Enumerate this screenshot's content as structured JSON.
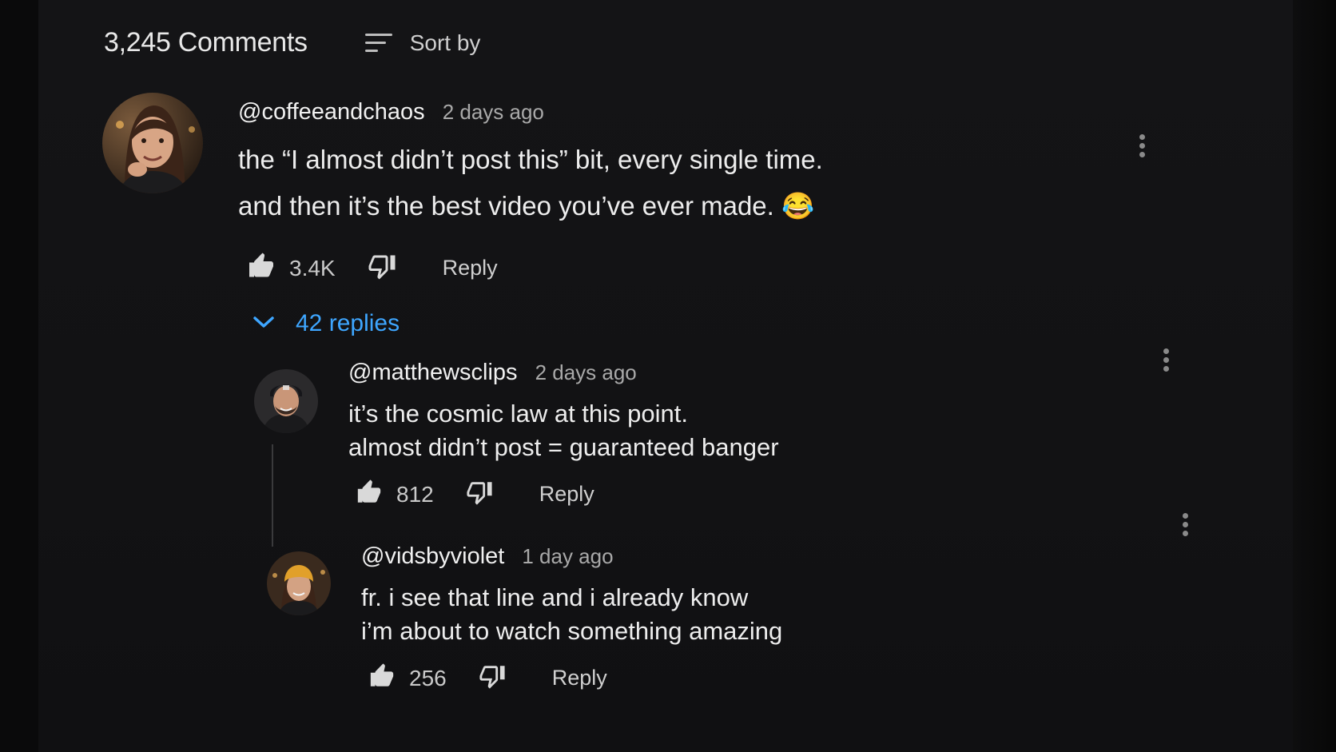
{
  "header": {
    "comment_count": "3,245 Comments",
    "sort_label": "Sort by",
    "sort_icon": "sort-icon"
  },
  "comment": {
    "author": "@coffeeandchaos",
    "time": "2 days ago",
    "lines": [
      "the “I almost didn’t post this” bit, every single time.",
      "and then it’s the best video you’ve ever made. 😂"
    ],
    "likes": "3.4K",
    "reply_label": "Reply"
  },
  "replies_toggle": {
    "label": "42 replies",
    "color": "#3ea6ff"
  },
  "replies": [
    {
      "author": "@matthewsclips",
      "time": "2 days ago",
      "lines": [
        "it’s the cosmic law at this point.",
        "almost didn’t post = guaranteed banger"
      ],
      "likes": "812",
      "reply_label": "Reply"
    },
    {
      "author": "@vidsbyviolet",
      "time": "1 day ago",
      "lines": [
        "fr. i see that line and i already know",
        "i’m about to watch something amazing"
      ],
      "likes": "256",
      "reply_label": "Reply"
    }
  ],
  "colors": {
    "background": "#121214",
    "text": "#ededed",
    "muted": "#a9a9a9",
    "link": "#3ea6ff"
  }
}
